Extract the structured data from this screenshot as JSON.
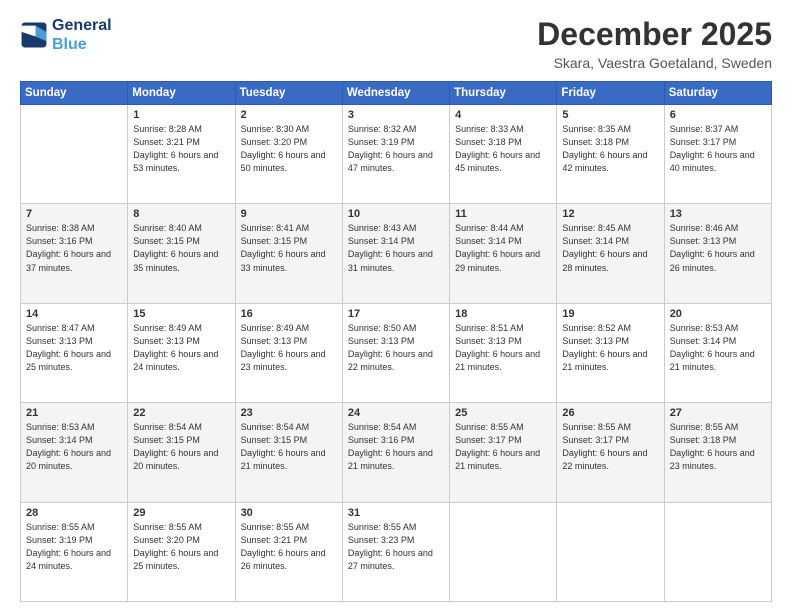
{
  "logo": {
    "line1": "General",
    "line2": "Blue"
  },
  "title": "December 2025",
  "location": "Skara, Vaestra Goetaland, Sweden",
  "days_of_week": [
    "Sunday",
    "Monday",
    "Tuesday",
    "Wednesday",
    "Thursday",
    "Friday",
    "Saturday"
  ],
  "weeks": [
    [
      {
        "day": "",
        "info": ""
      },
      {
        "day": "1",
        "info": "Sunrise: 8:28 AM\nSunset: 3:21 PM\nDaylight: 6 hours\nand 53 minutes."
      },
      {
        "day": "2",
        "info": "Sunrise: 8:30 AM\nSunset: 3:20 PM\nDaylight: 6 hours\nand 50 minutes."
      },
      {
        "day": "3",
        "info": "Sunrise: 8:32 AM\nSunset: 3:19 PM\nDaylight: 6 hours\nand 47 minutes."
      },
      {
        "day": "4",
        "info": "Sunrise: 8:33 AM\nSunset: 3:18 PM\nDaylight: 6 hours\nand 45 minutes."
      },
      {
        "day": "5",
        "info": "Sunrise: 8:35 AM\nSunset: 3:18 PM\nDaylight: 6 hours\nand 42 minutes."
      },
      {
        "day": "6",
        "info": "Sunrise: 8:37 AM\nSunset: 3:17 PM\nDaylight: 6 hours\nand 40 minutes."
      }
    ],
    [
      {
        "day": "7",
        "info": "Sunrise: 8:38 AM\nSunset: 3:16 PM\nDaylight: 6 hours\nand 37 minutes."
      },
      {
        "day": "8",
        "info": "Sunrise: 8:40 AM\nSunset: 3:15 PM\nDaylight: 6 hours\nand 35 minutes."
      },
      {
        "day": "9",
        "info": "Sunrise: 8:41 AM\nSunset: 3:15 PM\nDaylight: 6 hours\nand 33 minutes."
      },
      {
        "day": "10",
        "info": "Sunrise: 8:43 AM\nSunset: 3:14 PM\nDaylight: 6 hours\nand 31 minutes."
      },
      {
        "day": "11",
        "info": "Sunrise: 8:44 AM\nSunset: 3:14 PM\nDaylight: 6 hours\nand 29 minutes."
      },
      {
        "day": "12",
        "info": "Sunrise: 8:45 AM\nSunset: 3:14 PM\nDaylight: 6 hours\nand 28 minutes."
      },
      {
        "day": "13",
        "info": "Sunrise: 8:46 AM\nSunset: 3:13 PM\nDaylight: 6 hours\nand 26 minutes."
      }
    ],
    [
      {
        "day": "14",
        "info": "Sunrise: 8:47 AM\nSunset: 3:13 PM\nDaylight: 6 hours\nand 25 minutes."
      },
      {
        "day": "15",
        "info": "Sunrise: 8:49 AM\nSunset: 3:13 PM\nDaylight: 6 hours\nand 24 minutes."
      },
      {
        "day": "16",
        "info": "Sunrise: 8:49 AM\nSunset: 3:13 PM\nDaylight: 6 hours\nand 23 minutes."
      },
      {
        "day": "17",
        "info": "Sunrise: 8:50 AM\nSunset: 3:13 PM\nDaylight: 6 hours\nand 22 minutes."
      },
      {
        "day": "18",
        "info": "Sunrise: 8:51 AM\nSunset: 3:13 PM\nDaylight: 6 hours\nand 21 minutes."
      },
      {
        "day": "19",
        "info": "Sunrise: 8:52 AM\nSunset: 3:13 PM\nDaylight: 6 hours\nand 21 minutes."
      },
      {
        "day": "20",
        "info": "Sunrise: 8:53 AM\nSunset: 3:14 PM\nDaylight: 6 hours\nand 21 minutes."
      }
    ],
    [
      {
        "day": "21",
        "info": "Sunrise: 8:53 AM\nSunset: 3:14 PM\nDaylight: 6 hours\nand 20 minutes."
      },
      {
        "day": "22",
        "info": "Sunrise: 8:54 AM\nSunset: 3:15 PM\nDaylight: 6 hours\nand 20 minutes."
      },
      {
        "day": "23",
        "info": "Sunrise: 8:54 AM\nSunset: 3:15 PM\nDaylight: 6 hours\nand 21 minutes."
      },
      {
        "day": "24",
        "info": "Sunrise: 8:54 AM\nSunset: 3:16 PM\nDaylight: 6 hours\nand 21 minutes."
      },
      {
        "day": "25",
        "info": "Sunrise: 8:55 AM\nSunset: 3:17 PM\nDaylight: 6 hours\nand 21 minutes."
      },
      {
        "day": "26",
        "info": "Sunrise: 8:55 AM\nSunset: 3:17 PM\nDaylight: 6 hours\nand 22 minutes."
      },
      {
        "day": "27",
        "info": "Sunrise: 8:55 AM\nSunset: 3:18 PM\nDaylight: 6 hours\nand 23 minutes."
      }
    ],
    [
      {
        "day": "28",
        "info": "Sunrise: 8:55 AM\nSunset: 3:19 PM\nDaylight: 6 hours\nand 24 minutes."
      },
      {
        "day": "29",
        "info": "Sunrise: 8:55 AM\nSunset: 3:20 PM\nDaylight: 6 hours\nand 25 minutes."
      },
      {
        "day": "30",
        "info": "Sunrise: 8:55 AM\nSunset: 3:21 PM\nDaylight: 6 hours\nand 26 minutes."
      },
      {
        "day": "31",
        "info": "Sunrise: 8:55 AM\nSunset: 3:23 PM\nDaylight: 6 hours\nand 27 minutes."
      },
      {
        "day": "",
        "info": ""
      },
      {
        "day": "",
        "info": ""
      },
      {
        "day": "",
        "info": ""
      }
    ]
  ]
}
